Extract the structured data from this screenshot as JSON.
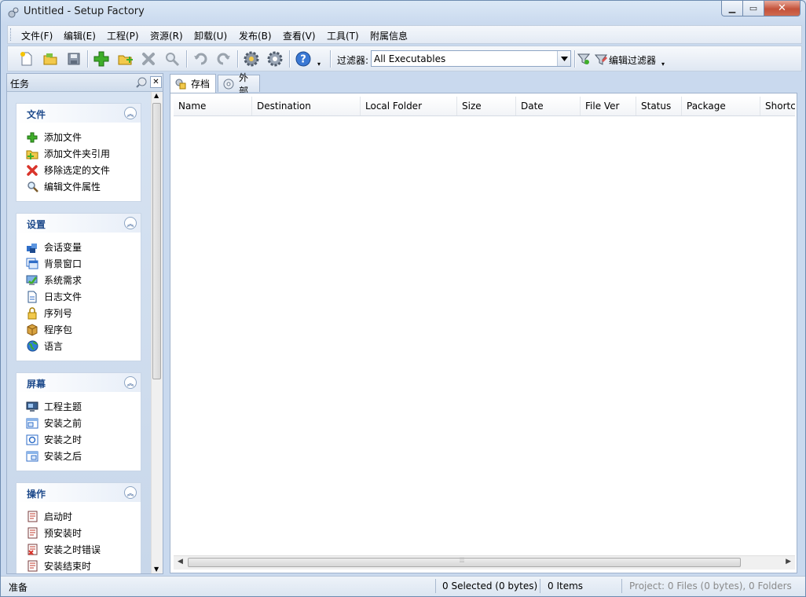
{
  "window": {
    "title": "Untitled - Setup Factory"
  },
  "menu": [
    "文件(F)",
    "编辑(E)",
    "工程(P)",
    "资源(R)",
    "卸载(U)",
    "发布(B)",
    "查看(V)",
    "工具(T)",
    "附属信息"
  ],
  "toolbar": {
    "filter_label": "过滤器:",
    "filter_value": "All Executables",
    "edit_filter_label": "编辑过滤器"
  },
  "task_panel": {
    "title": "任务",
    "groups": [
      {
        "title": "文件",
        "items": [
          "添加文件",
          "添加文件夹引用",
          "移除选定的文件",
          "编辑文件属性"
        ]
      },
      {
        "title": "设置",
        "items": [
          "会话变量",
          "背景窗口",
          "系统需求",
          "日志文件",
          "序列号",
          "程序包",
          "语言"
        ]
      },
      {
        "title": "屏幕",
        "items": [
          "工程主题",
          "安装之前",
          "安装之时",
          "安装之后"
        ]
      },
      {
        "title": "操作",
        "items": [
          "启动时",
          "预安装时",
          "安装之时错误",
          "安装结束时"
        ]
      }
    ]
  },
  "tabs": [
    "存档",
    "外部"
  ],
  "table": {
    "columns": [
      "Name",
      "Destination",
      "Local Folder",
      "Size",
      "Date",
      "File Ver",
      "Status",
      "Package",
      "Shortc"
    ]
  },
  "statusbar": {
    "ready": "准备",
    "selected": "0 Selected (0 bytes)",
    "items": "0 Items",
    "project": "Project: 0 Files (0 bytes), 0 Folders"
  }
}
